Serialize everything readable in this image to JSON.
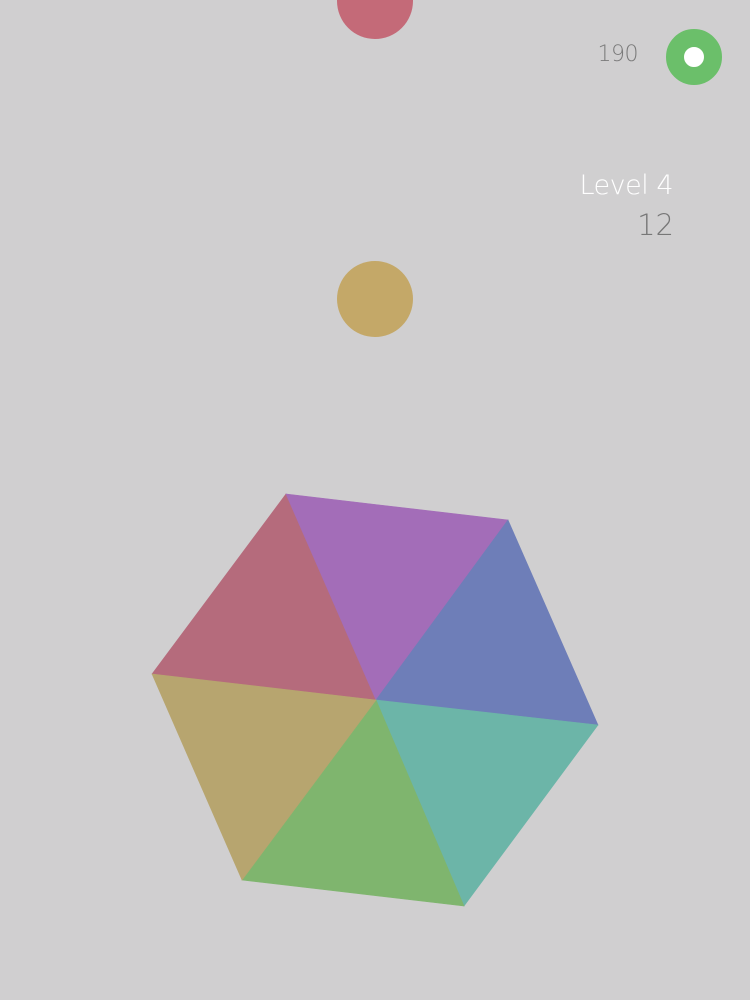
{
  "hud": {
    "score": "190",
    "level_label": "Level 4",
    "level_count": "12",
    "ring_color": "#6bbf6a"
  },
  "balls": [
    {
      "role": "falling-top",
      "color": "#c46a78"
    },
    {
      "role": "falling-next",
      "color": "#c4a868"
    }
  ],
  "hexagon": {
    "segments": [
      {
        "name": "red",
        "color": "#b56b7c"
      },
      {
        "name": "purple",
        "color": "#a36db8"
      },
      {
        "name": "blue",
        "color": "#6e7eb8"
      },
      {
        "name": "teal",
        "color": "#6cb5a8"
      },
      {
        "name": "green",
        "color": "#7fb56e"
      },
      {
        "name": "yellow",
        "color": "#b7a56f"
      }
    ]
  }
}
